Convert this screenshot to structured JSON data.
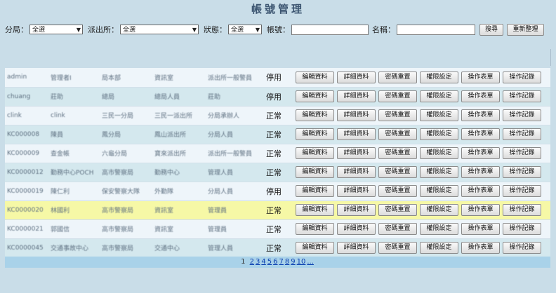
{
  "title": "帳號管理",
  "filters": {
    "branch_label": "分局：",
    "branch_value": "全選",
    "station_label": "派出所：",
    "station_value": "全選",
    "status_label": "狀態：",
    "status_value": "全選",
    "account_label": "帳號：",
    "account_value": "",
    "name_label": "名稱：",
    "name_value": "",
    "search_button": "搜尋",
    "reset_button": "重新整理"
  },
  "actions": [
    "編輯資料",
    "詳細資料",
    "密碼重置",
    "權限設定",
    "操作表單",
    "操作記錄"
  ],
  "rows": [
    {
      "account": "admin",
      "name": "管理者I",
      "branch": "局本部",
      "station": "資訊室",
      "role": "派出所一般警員",
      "status": "停用",
      "style": "r0"
    },
    {
      "account": "chuang",
      "name": "莊助",
      "branch": "總局",
      "station": "總局人員",
      "role": "莊助",
      "status": "停用",
      "style": "r1"
    },
    {
      "account": "clink",
      "name": "clink",
      "branch": "三民一分局",
      "station": "三民一派出所",
      "role": "分局承辦人",
      "status": "正常",
      "style": "r0"
    },
    {
      "account": "KC000008",
      "name": "陳員",
      "branch": "鳳分局",
      "station": "鳳山派出所",
      "role": "分局人員",
      "status": "正常",
      "style": "r1"
    },
    {
      "account": "KC000009",
      "name": "查金帳",
      "branch": "六龜分局",
      "station": "寶來派出所",
      "role": "派出所一般警員",
      "status": "正常",
      "style": "r0"
    },
    {
      "account": "KC0000012",
      "name": "勤務中心POCH",
      "branch": "高市警察局",
      "station": "勤務中心",
      "role": "管理人員",
      "status": "正常",
      "style": "r1"
    },
    {
      "account": "KC0000019",
      "name": "陳仁利",
      "branch": "保安警察大隊",
      "station": "外勤隊",
      "role": "分局人員",
      "status": "停用",
      "style": "r0"
    },
    {
      "account": "KC0000020",
      "name": "林國利",
      "branch": "高市警察局",
      "station": "資訊室",
      "role": "管理員",
      "status": "正常",
      "style": "hl"
    },
    {
      "account": "KC0000021",
      "name": "郭國信",
      "branch": "高市警察局",
      "station": "資訊室",
      "role": "管理員",
      "status": "正常",
      "style": "r0"
    },
    {
      "account": "KC0000045",
      "name": "交通事故中心",
      "branch": "高市警察局",
      "station": "交通中心",
      "role": "管理人員",
      "status": "正常",
      "style": "r1"
    }
  ],
  "pager": {
    "current": "1",
    "pages": [
      "2",
      "3",
      "4",
      "5",
      "6",
      "7",
      "8",
      "9",
      "10",
      "..."
    ]
  }
}
